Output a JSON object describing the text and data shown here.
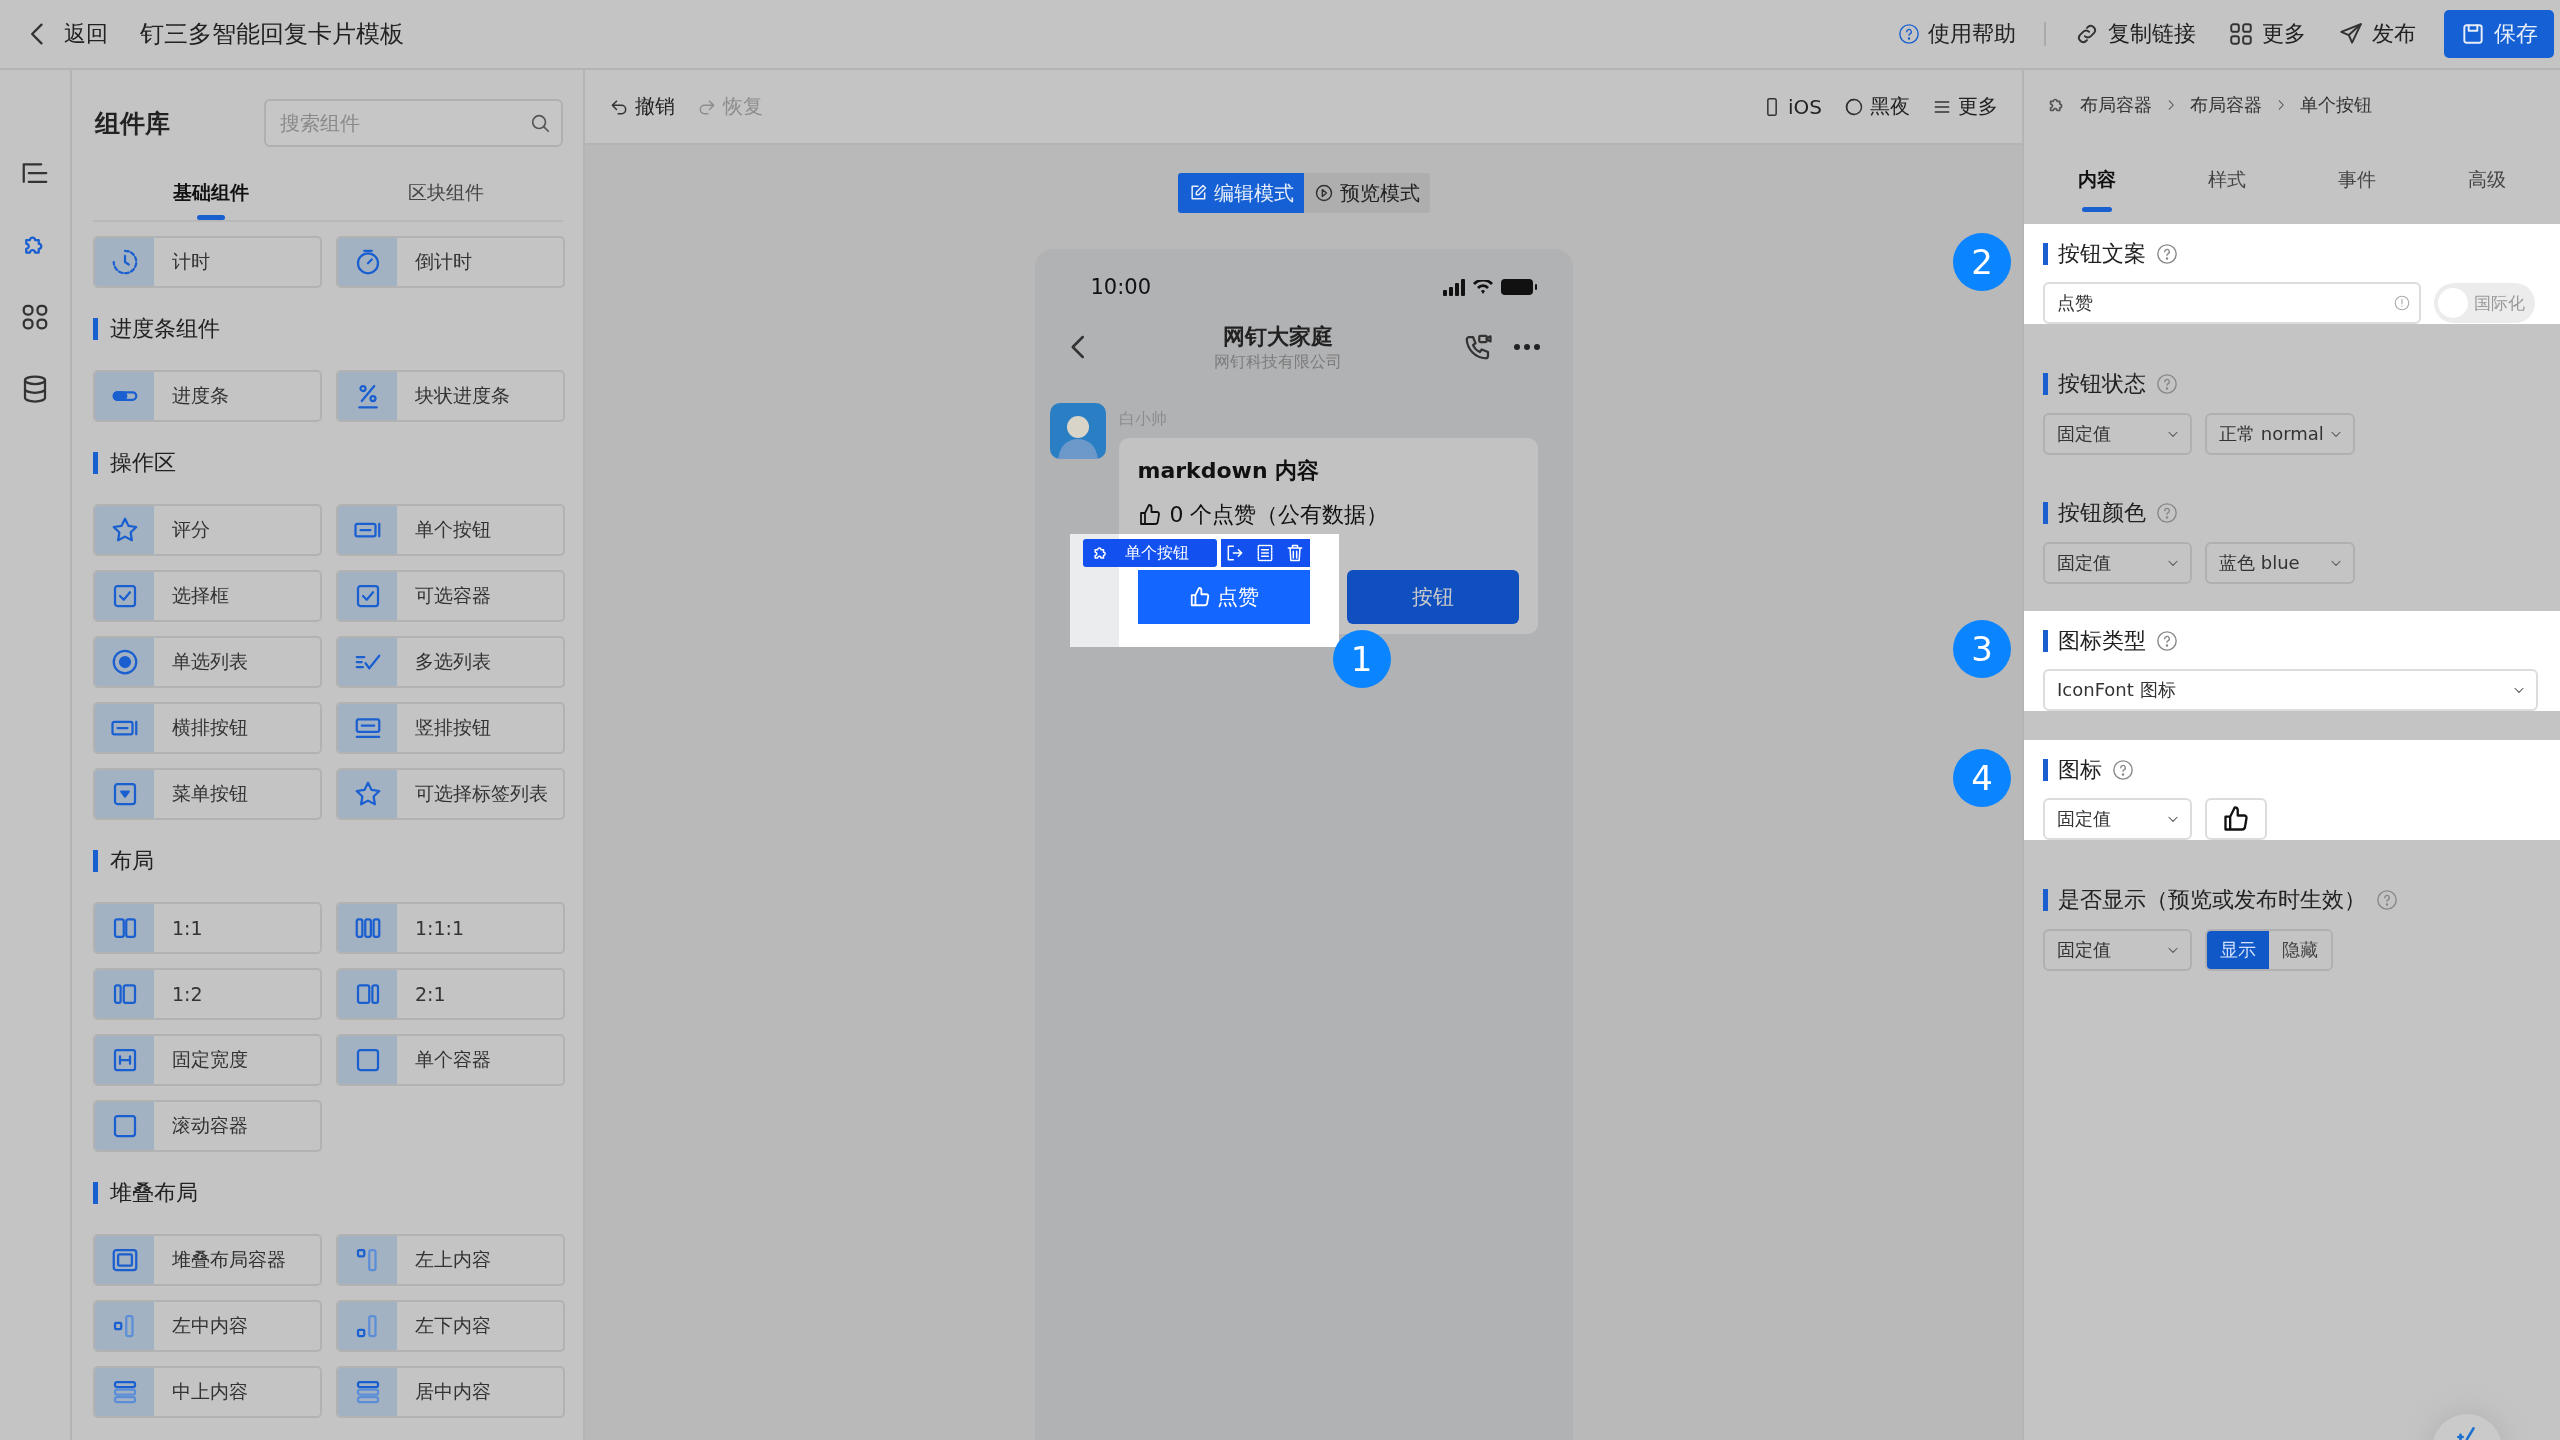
{
  "topbar": {
    "back": "返回",
    "title": "钉三多智能回复卡片模板",
    "actions": [
      {
        "kind": "help",
        "label": "使用帮助"
      },
      {
        "kind": "link",
        "label": "复制链接"
      },
      {
        "kind": "apps",
        "label": "更多"
      },
      {
        "kind": "send",
        "label": "发布"
      },
      {
        "kind": "save",
        "label": "保存"
      }
    ]
  },
  "rail": [
    {
      "kind": "outline",
      "selected": false
    },
    {
      "kind": "puzzle",
      "selected": true
    },
    {
      "kind": "apps",
      "selected": false
    },
    {
      "kind": "database",
      "selected": false
    }
  ],
  "library": {
    "title": "组件库",
    "search": {
      "placeholder": "搜索组件"
    },
    "tabs": [
      {
        "label": "基础组件",
        "selected": true
      },
      {
        "label": "区块组件",
        "selected": false
      }
    ],
    "groups": [
      {
        "items": [
          {
            "kind": "clock",
            "label": "计时"
          },
          {
            "kind": "timer",
            "label": "倒计时"
          }
        ]
      },
      {
        "title": "进度条组件",
        "items": [
          {
            "kind": "toggle",
            "label": "进度条"
          },
          {
            "kind": "percent",
            "label": "块状进度条"
          }
        ]
      },
      {
        "title": "操作区",
        "items": [
          {
            "kind": "star",
            "label": "评分"
          },
          {
            "kind": "btn",
            "label": "单个按钮"
          },
          {
            "kind": "checkbox",
            "label": "选择框"
          },
          {
            "kind": "checkbox",
            "label": "可选容器"
          },
          {
            "kind": "radio",
            "label": "单选列表"
          },
          {
            "kind": "checklist",
            "label": "多选列表"
          },
          {
            "kind": "btn",
            "label": "横排按钮"
          },
          {
            "kind": "btnv",
            "label": "竖排按钮"
          },
          {
            "kind": "dropdown",
            "label": "菜单按钮"
          },
          {
            "kind": "star",
            "label": "可选择标签列表"
          }
        ]
      },
      {
        "title": "布局",
        "items": [
          {
            "kind": "cols2",
            "label": "1:1"
          },
          {
            "kind": "cols3",
            "label": "1:1:1"
          },
          {
            "kind": "cols12",
            "label": "1:2"
          },
          {
            "kind": "cols21",
            "label": "2:1"
          },
          {
            "kind": "fixed",
            "label": "固定宽度"
          },
          {
            "kind": "square",
            "label": "单个容器"
          },
          {
            "kind": "square",
            "label": "滚动容器"
          }
        ]
      },
      {
        "title": "堆叠布局",
        "items": [
          {
            "kind": "stack",
            "label": "堆叠布局容器"
          },
          {
            "kind": "tl",
            "label": "左上内容"
          },
          {
            "kind": "ml",
            "label": "左中内容"
          },
          {
            "kind": "bl",
            "label": "左下内容"
          },
          {
            "kind": "tc",
            "label": "中上内容"
          },
          {
            "kind": "tc",
            "label": "居中内容"
          }
        ]
      }
    ]
  },
  "canvas": {
    "undo": "撤销",
    "redo": {
      "label": "恢复",
      "disabled": true
    },
    "tools": [
      {
        "kind": "phone",
        "label": "iOS"
      },
      {
        "kind": "moon",
        "label": "黑夜"
      },
      {
        "kind": "menu",
        "label": "更多"
      }
    ],
    "modes": [
      {
        "kind": "edit",
        "label": "编辑模式",
        "selected": true
      },
      {
        "kind": "play",
        "label": "预览模式",
        "selected": false
      }
    ],
    "phone": {
      "time": "10:00",
      "title": "网钉大家庭",
      "subtitle": "网钉科技有限公司",
      "sender": "白小帅",
      "card": {
        "title": "markdown 内容",
        "likes": "0 个点赞（公有数据）",
        "chip": "单个按钮",
        "buttons": [
          {
            "label": "点赞",
            "selected": true
          },
          {
            "label": "按钮",
            "selected": false
          }
        ]
      }
    },
    "marker": "1"
  },
  "inspector": {
    "breadcrumb": [
      "布局容器",
      "布局容器",
      "单个按钮"
    ],
    "tabs": [
      {
        "label": "内容",
        "selected": true
      },
      {
        "label": "样式",
        "selected": false
      },
      {
        "label": "事件",
        "selected": false
      },
      {
        "label": "高级",
        "selected": false
      }
    ],
    "sections": [
      {
        "kind": "text",
        "label": "按钮文案",
        "highlighted": true,
        "marker": "2",
        "value": "点赞",
        "toggle": {
          "label": "国际化",
          "on": false
        }
      },
      {
        "kind": "selects",
        "label": "按钮状态",
        "highlighted": false,
        "selects": [
          "固定值",
          "正常 normal"
        ]
      },
      {
        "kind": "selects",
        "label": "按钮颜色",
        "highlighted": false,
        "selects": [
          "固定值",
          "蓝色 blue"
        ]
      },
      {
        "kind": "wide",
        "label": "图标类型",
        "highlighted": true,
        "marker": "3",
        "value": "IconFont 图标"
      },
      {
        "kind": "icon",
        "label": "图标",
        "highlighted": true,
        "marker": "4",
        "select": "固定值"
      },
      {
        "kind": "segmented",
        "label": "是否显示（预览或发布时生效）",
        "highlighted": false,
        "select": "固定值",
        "options": [
          {
            "label": "显示",
            "selected": true
          },
          {
            "label": "隐藏",
            "selected": false
          }
        ]
      }
    ]
  }
}
